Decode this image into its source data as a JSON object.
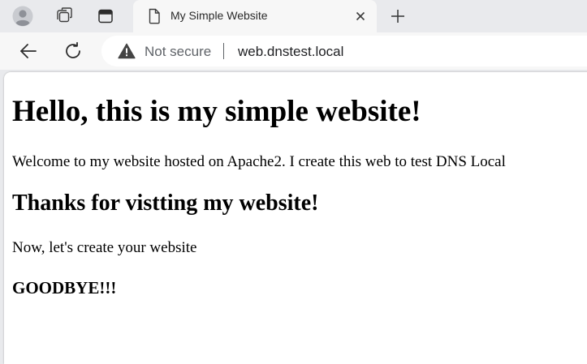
{
  "tab": {
    "title": "My Simple Website"
  },
  "address_bar": {
    "security_label": "Not secure",
    "url": "web.dnstest.local"
  },
  "page": {
    "heading": "Hello, this is my simple website!",
    "intro": "Welcome to my website hosted on Apache2. I create this web to test DNS Local",
    "subheading": "Thanks for vistting my website!",
    "body": "Now, let's create your website",
    "farewell": "GOODBYE!!!"
  },
  "icons": {
    "profile": "profile-avatar-icon",
    "workspaces": "workspaces-icon",
    "tab_actions": "tab-actions-icon",
    "page": "page-document-icon",
    "close": "close-icon",
    "new_tab": "plus-icon",
    "back": "back-arrow-icon",
    "reload": "reload-icon",
    "warning": "warning-triangle-icon"
  },
  "colors": {
    "chrome_bg": "#e9eaed",
    "active_tab_bg": "#f7f7f7",
    "page_bg": "#ffffff",
    "muted_text": "#5f6368"
  }
}
